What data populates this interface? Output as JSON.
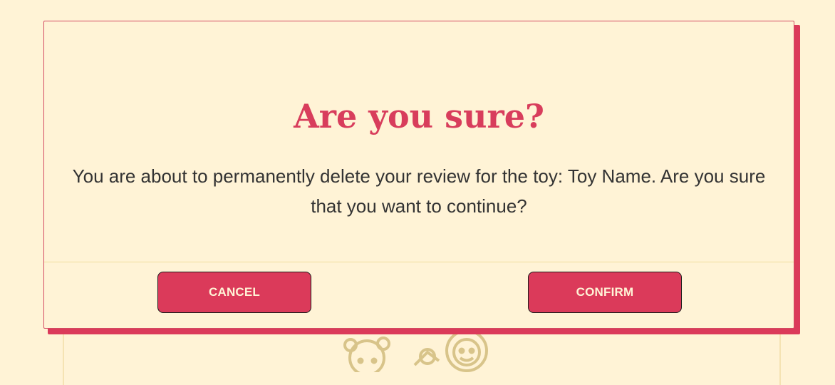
{
  "dialog": {
    "title": "Are you sure?",
    "message": "You are about to permanently delete your review for the toy: Toy Name. Are you sure that you want to continue?",
    "cancel_label": "CANCEL",
    "confirm_label": "CONFIRM"
  },
  "background": {
    "illustration_icon": "toys-outline-icon"
  },
  "colors": {
    "accent": "#db3a5a",
    "page_background": "#fff3d6",
    "text": "#333333",
    "illustration": "#d8c48a"
  }
}
